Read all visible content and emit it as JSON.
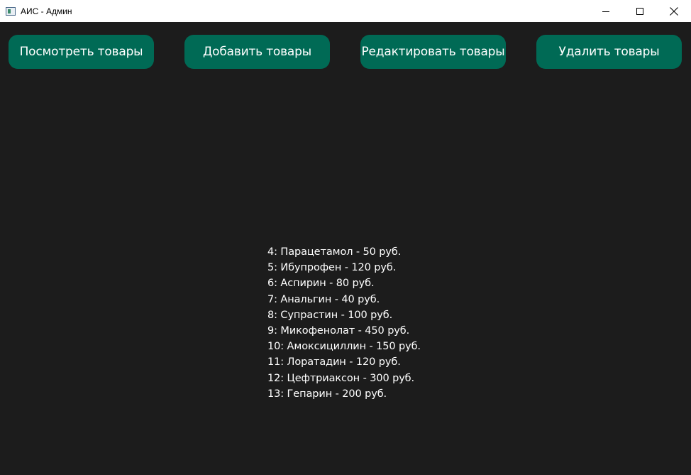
{
  "window": {
    "title": "АИС - Админ"
  },
  "toolbar": {
    "view_label": "Посмотреть товары",
    "add_label": "Добавить товары",
    "edit_label": "Редактировать товары",
    "delete_label": "Удалить товары"
  },
  "products": [
    "4: Парацетамол - 50 руб.",
    "5: Ибупрофен - 120 руб.",
    "6: Аспирин - 80 руб.",
    "7: Анальгин - 40 руб.",
    "8: Супрастин - 100 руб.",
    "9: Микофенолат - 450 руб.",
    "10: Амоксициллин - 150 руб.",
    "11: Лоратадин - 120 руб.",
    "12: Цефтриаксон - 300 руб.",
    "13: Гепарин - 200 руб."
  ],
  "colors": {
    "background": "#1c1c1c",
    "button": "#006a55",
    "text": "#ffffff"
  }
}
